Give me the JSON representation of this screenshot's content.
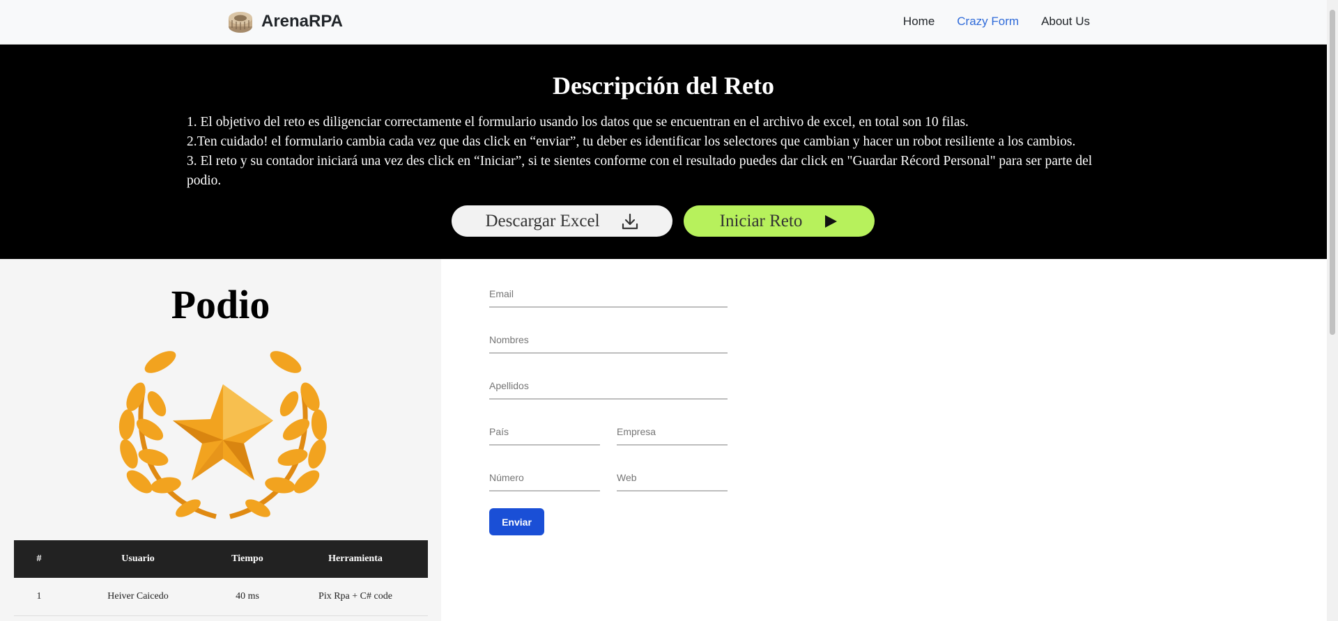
{
  "navbar": {
    "brand": "ArenaRPA",
    "links": [
      "Home",
      "Crazy Form",
      "About Us"
    ]
  },
  "hero": {
    "title": "Descripción del Reto",
    "lines": [
      "1. El objetivo del reto es diligenciar correctamente el formulario usando los datos que se encuentran en el archivo de excel, en total son 10 filas.",
      "2.Ten cuidado! el formulario cambia cada vez que das click en “enviar”, tu deber es identificar los selectores que cambian y hacer un robot resiliente a los cambios.",
      "3. El reto y su contador iniciará una vez des click en “Iniciar”, si te sientes conforme con el resultado puedes dar click en \"Guardar Récord Personal\" para ser parte del podio."
    ],
    "download_label": "Descargar Excel",
    "start_label": "Iniciar Reto"
  },
  "podium": {
    "title": "Podio",
    "columns": [
      "#",
      "Usuario",
      "Tiempo",
      "Herramienta"
    ],
    "rows": [
      [
        "1",
        "Heiver Caicedo",
        "40 ms",
        "Pix Rpa + C# code"
      ]
    ]
  },
  "form": {
    "email_placeholder": "Email",
    "nombres_placeholder": "Nombres",
    "apellidos_placeholder": "Apellidos",
    "pais_placeholder": "País",
    "empresa_placeholder": "Empresa",
    "numero_placeholder": "Número",
    "web_placeholder": "Web",
    "submit_label": "Enviar"
  }
}
